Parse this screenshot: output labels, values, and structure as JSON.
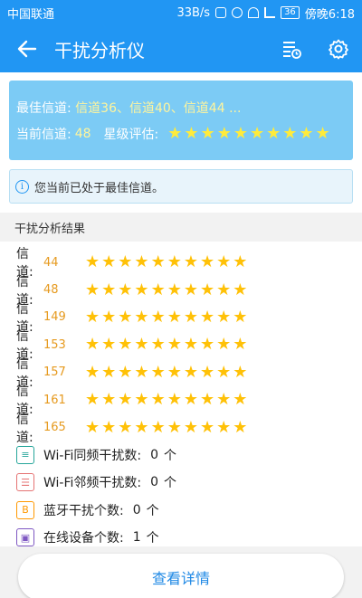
{
  "status_bar": {
    "carrier": "中国联通",
    "speed": "33B/s",
    "battery": "36",
    "time": "傍晚6:18"
  },
  "app_bar": {
    "title": "干扰分析仪"
  },
  "summary": {
    "best_label": "最佳信道:",
    "best_value": "信道36、信道40、信道44 ...",
    "current_label": "当前信道:",
    "current_value": "48",
    "rating_label": "星级评估:",
    "rating_stars": 10
  },
  "notice": {
    "text": "您当前已处于最佳信道。"
  },
  "section": {
    "title": "干扰分析结果"
  },
  "channels": [
    {
      "label": "信道:",
      "number": "44",
      "stars": 10
    },
    {
      "label": "信道:",
      "number": "48",
      "stars": 10
    },
    {
      "label": "信道:",
      "number": "149",
      "stars": 10
    },
    {
      "label": "信道:",
      "number": "153",
      "stars": 10
    },
    {
      "label": "信道:",
      "number": "157",
      "stars": 10
    },
    {
      "label": "信道:",
      "number": "161",
      "stars": 10
    },
    {
      "label": "信道:",
      "number": "165",
      "stars": 10
    }
  ],
  "stats": [
    {
      "icon": "wifi-icon",
      "label": "Wi-Fi同频干扰数:",
      "value": "0",
      "unit": "个",
      "color": "#26a69a"
    },
    {
      "icon": "wifi-adjacent-icon",
      "label": "Wi-Fi邻频干扰数:",
      "value": "0",
      "unit": "个",
      "color": "#e57373"
    },
    {
      "icon": "bluetooth-icon",
      "label": "蓝牙干扰个数:",
      "value": "0",
      "unit": "个",
      "color": "#ff9800"
    },
    {
      "icon": "device-icon",
      "label": "在线设备个数:",
      "value": "1",
      "unit": "个",
      "color": "#7e57c2"
    }
  ],
  "detail_button": {
    "label": "查看详情"
  },
  "colors": {
    "primary": "#2196f3",
    "summary_bg": "#7ccbf5",
    "star": "#ffc107",
    "channel_number": "#e69a1f",
    "button_text": "#1e88e5"
  }
}
